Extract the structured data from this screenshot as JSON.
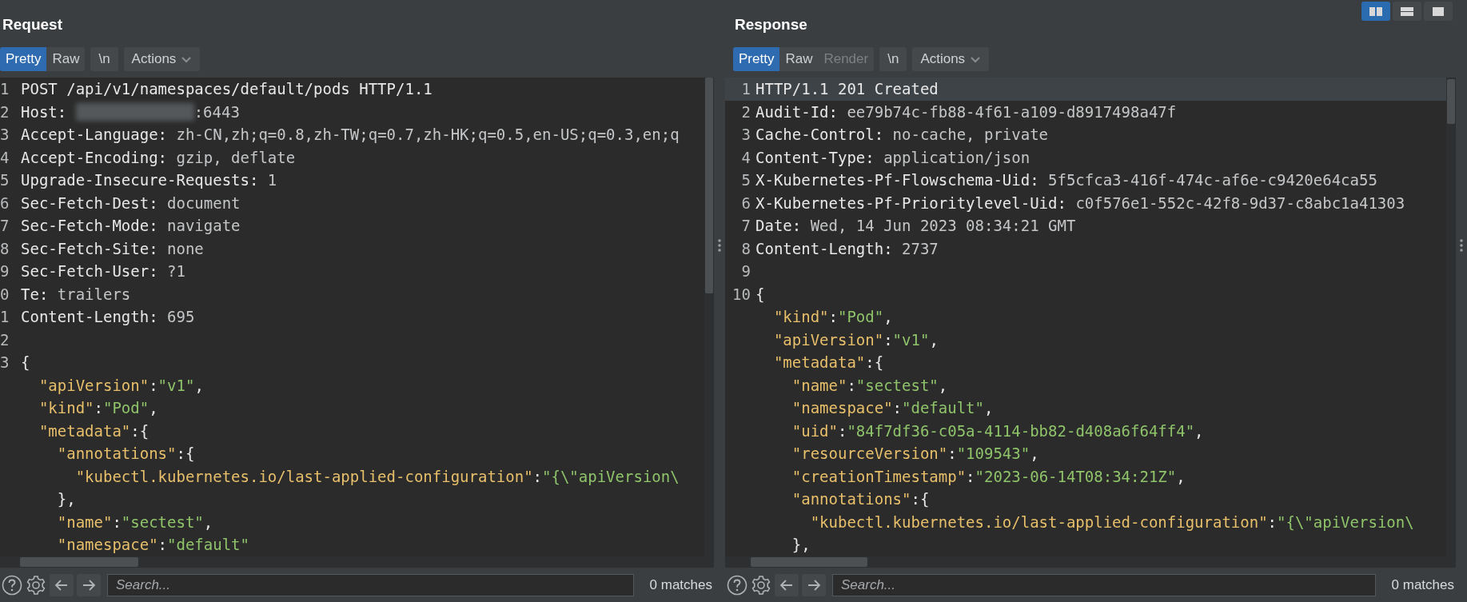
{
  "request": {
    "title": "Request",
    "tabs": [
      {
        "label": "Pretty",
        "selected": true,
        "disabled": false
      },
      {
        "label": "Raw",
        "selected": false,
        "disabled": false
      }
    ],
    "buttons": [
      {
        "label": "\\n",
        "kind": "plain"
      },
      {
        "label": "Actions",
        "kind": "menu"
      }
    ],
    "lines": [
      {
        "num": "1",
        "highlighted": false,
        "parts": [
          {
            "kind": "key",
            "text": "POST /api/v1/namespaces/default/pods HTTP/1.1"
          }
        ]
      },
      {
        "num": "2",
        "highlighted": false,
        "parts": [
          {
            "kind": "key",
            "text": "Host: "
          },
          {
            "kind": "redacted"
          },
          {
            "kind": "value",
            "text": ":6443"
          }
        ]
      },
      {
        "num": "3",
        "highlighted": false,
        "parts": [
          {
            "kind": "key",
            "text": "Accept-Language: "
          },
          {
            "kind": "value",
            "text": "zh-CN,zh;q=0.8,zh-TW;q=0.7,zh-HK;q=0.5,en-US;q=0.3,en;q"
          }
        ]
      },
      {
        "num": "4",
        "highlighted": false,
        "parts": [
          {
            "kind": "key",
            "text": "Accept-Encoding: "
          },
          {
            "kind": "value",
            "text": "gzip, deflate"
          }
        ]
      },
      {
        "num": "5",
        "highlighted": false,
        "parts": [
          {
            "kind": "key",
            "text": "Upgrade-Insecure-Requests: "
          },
          {
            "kind": "value",
            "text": "1"
          }
        ]
      },
      {
        "num": "6",
        "highlighted": false,
        "parts": [
          {
            "kind": "key",
            "text": "Sec-Fetch-Dest: "
          },
          {
            "kind": "value",
            "text": "document"
          }
        ]
      },
      {
        "num": "7",
        "highlighted": false,
        "parts": [
          {
            "kind": "key",
            "text": "Sec-Fetch-Mode: "
          },
          {
            "kind": "value",
            "text": "navigate"
          }
        ]
      },
      {
        "num": "8",
        "highlighted": false,
        "parts": [
          {
            "kind": "key",
            "text": "Sec-Fetch-Site: "
          },
          {
            "kind": "value",
            "text": "none"
          }
        ]
      },
      {
        "num": "9",
        "highlighted": false,
        "parts": [
          {
            "kind": "key",
            "text": "Sec-Fetch-User: "
          },
          {
            "kind": "value",
            "text": "?1"
          }
        ]
      },
      {
        "num": "0",
        "highlighted": false,
        "parts": [
          {
            "kind": "key",
            "text": "Te: "
          },
          {
            "kind": "value",
            "text": "trailers"
          }
        ]
      },
      {
        "num": "1",
        "highlighted": false,
        "parts": [
          {
            "kind": "key",
            "text": "Content-Length: "
          },
          {
            "kind": "value",
            "text": "695"
          }
        ]
      },
      {
        "num": "2",
        "highlighted": false
      },
      {
        "num": "3",
        "highlighted": false,
        "parts": [
          {
            "kind": "punct",
            "text": "{"
          }
        ]
      },
      {
        "highlighted": false,
        "parts": [
          {
            "kind": "jkey",
            "text": "  \"apiVersion\""
          },
          {
            "kind": "punct",
            "text": ":"
          },
          {
            "kind": "jstr",
            "text": "\"v1\""
          },
          {
            "kind": "punct",
            "text": ","
          }
        ]
      },
      {
        "highlighted": false,
        "parts": [
          {
            "kind": "jkey",
            "text": "  \"kind\""
          },
          {
            "kind": "punct",
            "text": ":"
          },
          {
            "kind": "jstr",
            "text": "\"Pod\""
          },
          {
            "kind": "punct",
            "text": ","
          }
        ]
      },
      {
        "highlighted": false,
        "parts": [
          {
            "kind": "jkey",
            "text": "  \"metadata\""
          },
          {
            "kind": "punct",
            "text": ":{"
          }
        ]
      },
      {
        "highlighted": false,
        "parts": [
          {
            "kind": "jkey",
            "text": "    \"annotations\""
          },
          {
            "kind": "punct",
            "text": ":{"
          }
        ]
      },
      {
        "highlighted": false,
        "parts": [
          {
            "kind": "jkey",
            "text": "      \"kubectl.kubernetes.io/last-applied-configuration\""
          },
          {
            "kind": "punct",
            "text": ":"
          },
          {
            "kind": "jstr",
            "text": "\"{\\\"apiVersion\\"
          }
        ]
      },
      {
        "highlighted": false,
        "parts": [
          {
            "kind": "punct",
            "text": "    },"
          }
        ]
      },
      {
        "highlighted": false,
        "parts": [
          {
            "kind": "jkey",
            "text": "    \"name\""
          },
          {
            "kind": "punct",
            "text": ":"
          },
          {
            "kind": "jstr",
            "text": "\"sectest\""
          },
          {
            "kind": "punct",
            "text": ","
          }
        ]
      },
      {
        "highlighted": false,
        "parts": [
          {
            "kind": "jkey",
            "text": "    \"namespace\""
          },
          {
            "kind": "punct",
            "text": ":"
          },
          {
            "kind": "jstr",
            "text": "\"default\""
          }
        ]
      }
    ],
    "search": {
      "placeholder": "Search..."
    },
    "matches": "0 matches"
  },
  "response": {
    "title": "Response",
    "layout_buttons": [
      {
        "selected": true
      },
      {
        "selected": false
      },
      {
        "selected": false
      }
    ],
    "tabs": [
      {
        "label": "Pretty",
        "selected": true,
        "disabled": false
      },
      {
        "label": "Raw",
        "selected": false,
        "disabled": false
      },
      {
        "label": "Render",
        "selected": false,
        "disabled": true
      }
    ],
    "buttons": [
      {
        "label": "\\n",
        "kind": "plain"
      },
      {
        "label": "Actions",
        "kind": "menu"
      }
    ],
    "lines": [
      {
        "num": "1",
        "highlighted": true,
        "parts": [
          {
            "kind": "key",
            "text": "HTTP/1.1 201 Created"
          }
        ]
      },
      {
        "num": "2",
        "highlighted": false,
        "parts": [
          {
            "kind": "key",
            "text": "Audit-Id: "
          },
          {
            "kind": "value",
            "text": "ee79b74c-fb88-4f61-a109-d8917498a47f"
          }
        ]
      },
      {
        "num": "3",
        "highlighted": false,
        "parts": [
          {
            "kind": "key",
            "text": "Cache-Control: "
          },
          {
            "kind": "value",
            "text": "no-cache, private"
          }
        ]
      },
      {
        "num": "4",
        "highlighted": false,
        "parts": [
          {
            "kind": "key",
            "text": "Content-Type: "
          },
          {
            "kind": "value",
            "text": "application/json"
          }
        ]
      },
      {
        "num": "5",
        "highlighted": false,
        "parts": [
          {
            "kind": "key",
            "text": "X-Kubernetes-Pf-Flowschema-Uid: "
          },
          {
            "kind": "value",
            "text": "5f5cfca3-416f-474c-af6e-c9420e64ca55"
          }
        ]
      },
      {
        "num": "6",
        "highlighted": false,
        "parts": [
          {
            "kind": "key",
            "text": "X-Kubernetes-Pf-Prioritylevel-Uid: "
          },
          {
            "kind": "value",
            "text": "c0f576e1-552c-42f8-9d37-c8abc1a41303"
          }
        ]
      },
      {
        "num": "7",
        "highlighted": false,
        "parts": [
          {
            "kind": "key",
            "text": "Date: "
          },
          {
            "kind": "value",
            "text": "Wed, 14 Jun 2023 08:34:21 GMT"
          }
        ]
      },
      {
        "num": "8",
        "highlighted": false,
        "parts": [
          {
            "kind": "key",
            "text": "Content-Length: "
          },
          {
            "kind": "value",
            "text": "2737"
          }
        ]
      },
      {
        "num": "9",
        "highlighted": false
      },
      {
        "num": "10",
        "highlighted": false,
        "parts": [
          {
            "kind": "punct",
            "text": "{"
          }
        ]
      },
      {
        "highlighted": false,
        "parts": [
          {
            "kind": "jkey",
            "text": "  \"kind\""
          },
          {
            "kind": "punct",
            "text": ":"
          },
          {
            "kind": "jstr",
            "text": "\"Pod\""
          },
          {
            "kind": "punct",
            "text": ","
          }
        ]
      },
      {
        "highlighted": false,
        "parts": [
          {
            "kind": "jkey",
            "text": "  \"apiVersion\""
          },
          {
            "kind": "punct",
            "text": ":"
          },
          {
            "kind": "jstr",
            "text": "\"v1\""
          },
          {
            "kind": "punct",
            "text": ","
          }
        ]
      },
      {
        "highlighted": false,
        "parts": [
          {
            "kind": "jkey",
            "text": "  \"metadata\""
          },
          {
            "kind": "punct",
            "text": ":{"
          }
        ]
      },
      {
        "highlighted": false,
        "parts": [
          {
            "kind": "jkey",
            "text": "    \"name\""
          },
          {
            "kind": "punct",
            "text": ":"
          },
          {
            "kind": "jstr",
            "text": "\"sectest\""
          },
          {
            "kind": "punct",
            "text": ","
          }
        ]
      },
      {
        "highlighted": false,
        "parts": [
          {
            "kind": "jkey",
            "text": "    \"namespace\""
          },
          {
            "kind": "punct",
            "text": ":"
          },
          {
            "kind": "jstr",
            "text": "\"default\""
          },
          {
            "kind": "punct",
            "text": ","
          }
        ]
      },
      {
        "highlighted": false,
        "parts": [
          {
            "kind": "jkey",
            "text": "    \"uid\""
          },
          {
            "kind": "punct",
            "text": ":"
          },
          {
            "kind": "jstr",
            "text": "\"84f7df36-c05a-4114-bb82-d408a6f64ff4\""
          },
          {
            "kind": "punct",
            "text": ","
          }
        ]
      },
      {
        "highlighted": false,
        "parts": [
          {
            "kind": "jkey",
            "text": "    \"resourceVersion\""
          },
          {
            "kind": "punct",
            "text": ":"
          },
          {
            "kind": "jstr",
            "text": "\"109543\""
          },
          {
            "kind": "punct",
            "text": ","
          }
        ]
      },
      {
        "highlighted": false,
        "parts": [
          {
            "kind": "jkey",
            "text": "    \"creationTimestamp\""
          },
          {
            "kind": "punct",
            "text": ":"
          },
          {
            "kind": "jstr",
            "text": "\"2023-06-14T08:34:21Z\""
          },
          {
            "kind": "punct",
            "text": ","
          }
        ]
      },
      {
        "highlighted": false,
        "parts": [
          {
            "kind": "jkey",
            "text": "    \"annotations\""
          },
          {
            "kind": "punct",
            "text": ":{"
          }
        ]
      },
      {
        "highlighted": false,
        "parts": [
          {
            "kind": "jkey",
            "text": "      \"kubectl.kubernetes.io/last-applied-configuration\""
          },
          {
            "kind": "punct",
            "text": ":"
          },
          {
            "kind": "jstr",
            "text": "\"{\\\"apiVersion\\"
          }
        ]
      },
      {
        "highlighted": false,
        "parts": [
          {
            "kind": "punct",
            "text": "    },"
          }
        ]
      }
    ],
    "search": {
      "placeholder": "Search..."
    },
    "matches": "0 matches"
  }
}
